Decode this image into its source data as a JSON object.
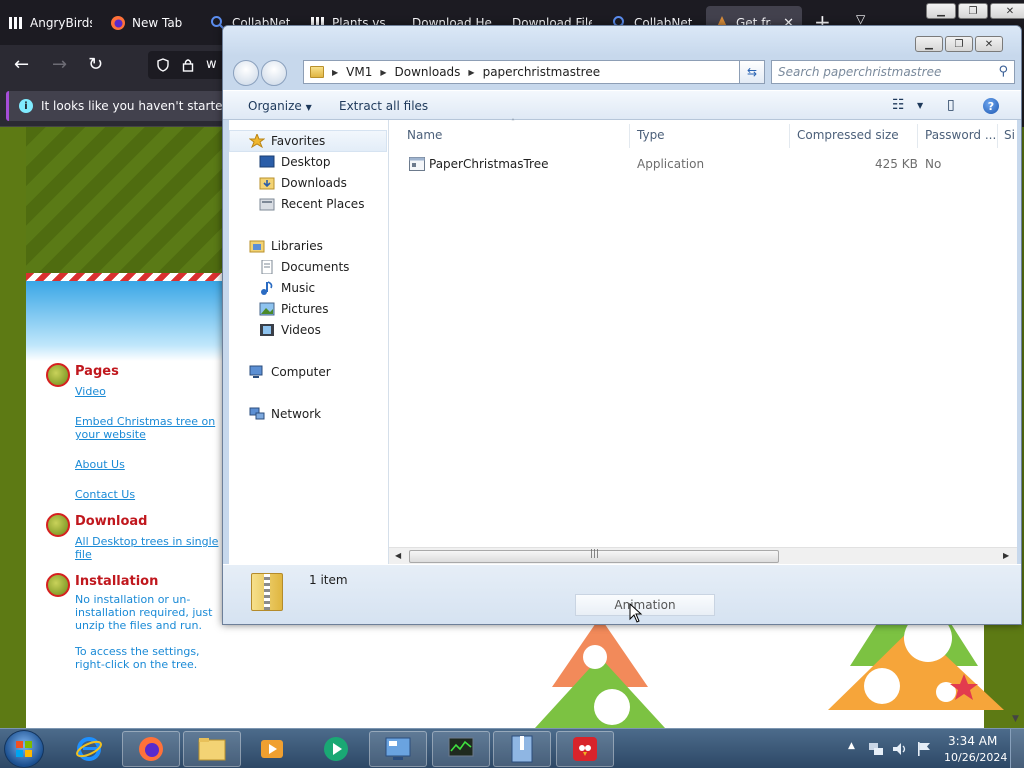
{
  "browser": {
    "tabs": [
      {
        "label": "AngryBirds",
        "icon": "library-icon"
      },
      {
        "label": "New Tab",
        "icon": "firefox-icon"
      },
      {
        "label": "CollabNet",
        "icon": "search-icon"
      },
      {
        "label": "Plants vs",
        "icon": "library-icon"
      },
      {
        "label": "Download Her",
        "icon": ""
      },
      {
        "label": "Download File",
        "icon": ""
      },
      {
        "label": "CollabNet",
        "icon": "search-icon"
      },
      {
        "label": "Get free",
        "icon": "tree-icon",
        "active": true
      }
    ],
    "url_partial": "w",
    "notice_text": "It looks like you haven't started Fir"
  },
  "website": {
    "sections": [
      {
        "title": "Pages",
        "links": [
          "Video",
          "Embed Christmas tree on your website",
          "About Us",
          "Contact Us"
        ]
      },
      {
        "title": "Download",
        "links": [
          "All Desktop trees in single file"
        ]
      },
      {
        "title": "Installation",
        "text": [
          "No installation or un-installation required, just unzip the files and run.",
          "To access the settings, right-click on the tree."
        ]
      }
    ]
  },
  "explorer": {
    "breadcrumb": [
      "VM1",
      "Downloads",
      "paperchristmastree"
    ],
    "search_placeholder": "Search paperchristmastree",
    "toolbar": {
      "organize": "Organize",
      "extract_all": "Extract all files"
    },
    "nav": {
      "favorites": "Favorites",
      "favorites_items": [
        "Desktop",
        "Downloads",
        "Recent Places"
      ],
      "libraries": "Libraries",
      "libraries_items": [
        "Documents",
        "Music",
        "Pictures",
        "Videos"
      ],
      "computer": "Computer",
      "network": "Network"
    },
    "columns": [
      "Name",
      "Type",
      "Compressed size",
      "Password ...",
      "Si"
    ],
    "files": [
      {
        "name": "PaperChristmasTree",
        "type": "Application",
        "compressed_size": "425 KB",
        "password": "No"
      }
    ],
    "status": "1 item"
  },
  "animation_button": "Animation",
  "taskbar": {
    "time": "3:34 AM",
    "date": "10/26/2024"
  }
}
